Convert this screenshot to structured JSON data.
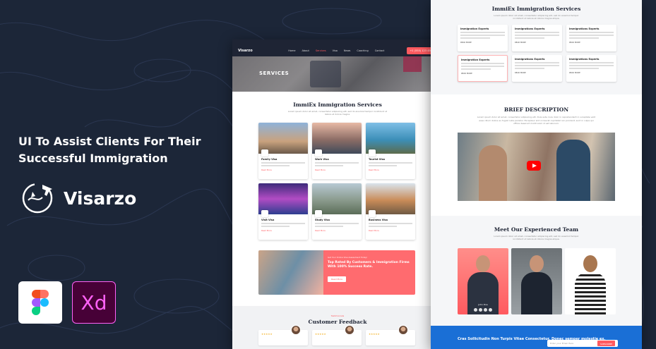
{
  "promo": {
    "title": "UI To Assist Clients For Their Successful Immigration",
    "brand": "Visarzo",
    "tools": [
      "figma-icon",
      "xd-icon"
    ],
    "xd_label": "Xd"
  },
  "mock1": {
    "nav": {
      "logo": "Visarzo",
      "menu": [
        "Home",
        "About",
        "Services",
        "Visa",
        "News",
        "Coaching",
        "Contact"
      ],
      "active_index": 2,
      "call": "+1 (555) 123 4567"
    },
    "hero_title": "SERVICES",
    "section_title": "ImmiEx Immigration Services",
    "section_sub": "Lorem ipsum dolor sit amet, consectetur adipiscing elit, sed do eiusmod tempor incididunt ut labore et dolore magna.",
    "cards": [
      {
        "title": "Family Visa",
        "link": "Read More"
      },
      {
        "title": "Work Visa",
        "link": "Read More"
      },
      {
        "title": "Tourist Visa",
        "link": "Read More"
      },
      {
        "title": "Visit Visa",
        "link": "Read More"
      },
      {
        "title": "Study Visa",
        "link": "Read More"
      },
      {
        "title": "Business Visa",
        "link": "Read More"
      }
    ],
    "banner": {
      "small": "Get Your Online Visa Assessment Today!",
      "big": "Top Rated By Customers & Immigration Firms With 100% Success Rate.",
      "button": "Read More"
    },
    "feedback": {
      "tag": "Testimonials",
      "title": "Customer Feedback",
      "stars": "★★★★★"
    }
  },
  "mock2": {
    "section_title": "ImmiEx Immigration Services",
    "section_sub": "Lorem ipsum dolor sit amet, consectetur adipiscing elit, sed do eiusmod tempor incididunt ut labore et dolore magna aliqua.",
    "cards": [
      {
        "title": "Immigration Experts",
        "link": "READ MORE"
      },
      {
        "title": "Immigrations Experts",
        "link": "READ MORE"
      },
      {
        "title": "Immigrations Experts",
        "link": "READ MORE"
      },
      {
        "title": "Immigration Experts",
        "link": "READ MORE"
      },
      {
        "title": "Immigrations Experts",
        "link": "READ MORE"
      },
      {
        "title": "Immigrations Experts",
        "link": "READ MORE"
      }
    ],
    "brief_title": "BRIEF DESCRIPTION",
    "brief_sub": "Lorem ipsum dolor sit amet, consectetur adipiscing elit. Duis aute irure dolor in reprehenderit in voluptate velit esse cillum dolore eu fugiat nulla pariatur. Excepteur sint occaecat cupidatat non proident, sunt in culpa qui officia deserunt mollit anim id est laborum.",
    "team_title": "Meet Our Experienced Team",
    "team_sub": "Lorem ipsum dolor sit amet, consectetur adipiscing elit, sed do eiusmod tempor incididunt ut labore et dolore magna aliqua.",
    "team": [
      {
        "name": "John Doe"
      },
      {
        "name": ""
      },
      {
        "name": ""
      }
    ],
    "newsletter": {
      "text": "Cras Sollicitudin Non Turpis Vitae Consectetur. Donec semper molestie ex,",
      "placeholder": "Enter your Email Here",
      "button": "SUBSCRIBE"
    }
  }
}
